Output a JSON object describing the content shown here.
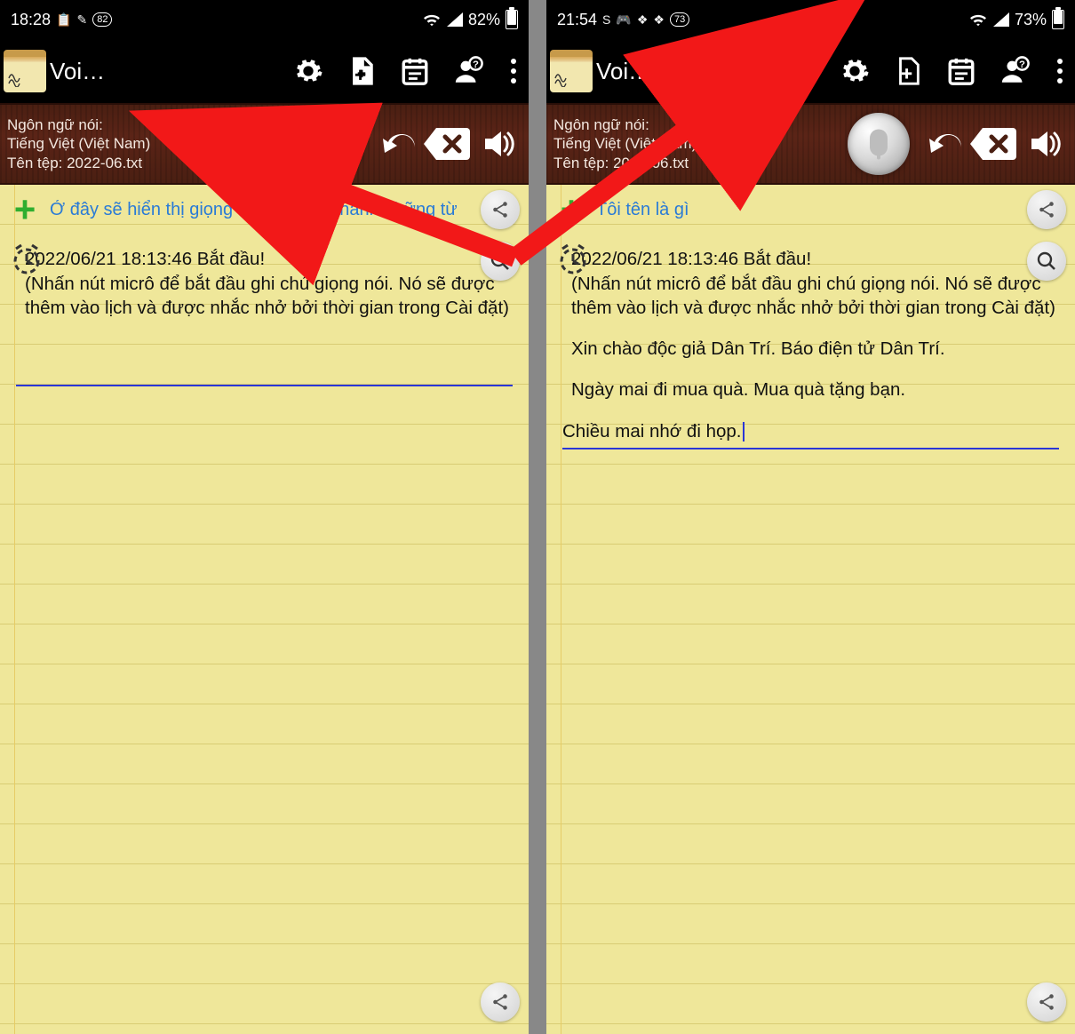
{
  "left": {
    "status": {
      "time": "18:28",
      "battery_pct": "82%",
      "badge": "82",
      "icons": [
        "cc",
        "edit",
        "badge"
      ]
    },
    "app": {
      "title": "Voi…"
    },
    "wood": {
      "lang_label": "Ngôn ngữ nói:",
      "lang_value": "Tiếng Việt (Việt Nam)",
      "file_label": "Tên tệp: 2022-06.txt"
    },
    "top_text": "Ở đây sẽ hiển thị giọng nói của bạn thành những từ",
    "note": {
      "line1": "2022/06/21 18:13:46 Bắt đầu!",
      "line2": "(Nhấn nút micrô để bắt đầu ghi chú giọng nói. Nó sẽ được thêm vào lịch và được nhắc nhở bởi thời gian trong Cài đặt)"
    }
  },
  "right": {
    "status": {
      "time": "21:54",
      "battery_pct": "73%",
      "badge": "73"
    },
    "app": {
      "title": "Voi…"
    },
    "wood": {
      "lang_label": "Ngôn ngữ nói:",
      "lang_value": "Tiếng Việt (Việt Nam)",
      "file_label": "Tên tệp: 2022-06.txt"
    },
    "top_text": "Tôi tên là gì",
    "note": {
      "line1": "2022/06/21 18:13:46 Bắt đầu!",
      "line2": "(Nhấn nút micrô để bắt đầu ghi chú giọng nói. Nó sẽ được thêm vào lịch và được nhắc nhở bởi thời gian trong Cài đặt)",
      "p1": "Xin chào độc giả Dân Trí. Báo điện tử Dân Trí.",
      "p2": "Ngày mai đi mua quà. Mua quà tặng bạn.",
      "p3": "Chiều mai nhớ đi họp."
    }
  },
  "icons": {
    "settings": "settings",
    "newfile": "new-file",
    "calendar": "calendar",
    "account": "account-help",
    "more": "more",
    "undo": "undo",
    "delete": "delete",
    "speaker": "speaker",
    "mic": "mic",
    "share": "share",
    "search": "search",
    "alarm": "alarm",
    "plus": "plus"
  },
  "colors": {
    "accent_blue": "#2a36d6",
    "link_blue": "#2a7bd6",
    "arrow_red": "#f21818"
  }
}
